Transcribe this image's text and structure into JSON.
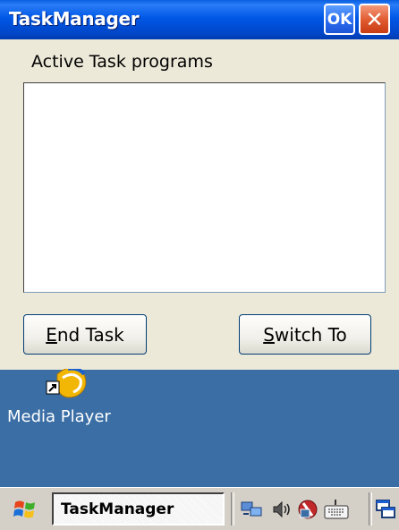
{
  "window": {
    "title": "TaskManager",
    "ok_label": "OK",
    "close_label": "✕",
    "active_tasks_label": "Active Task programs",
    "tasks": [],
    "end_task_button": {
      "accel": "E",
      "rest": "nd Task"
    },
    "switch_to_button": {
      "accel": "S",
      "rest": "witch To"
    }
  },
  "desktop": {
    "icons": [
      {
        "label": "Media Player",
        "icon": "media-player-icon"
      }
    ]
  },
  "taskbar": {
    "task_button_label": "TaskManager",
    "start_icon": "windows-flag-icon",
    "tray_icons": [
      "network-icon",
      "volume-icon",
      "security-icon",
      "keyboard-icon",
      "desktop-icon"
    ]
  }
}
